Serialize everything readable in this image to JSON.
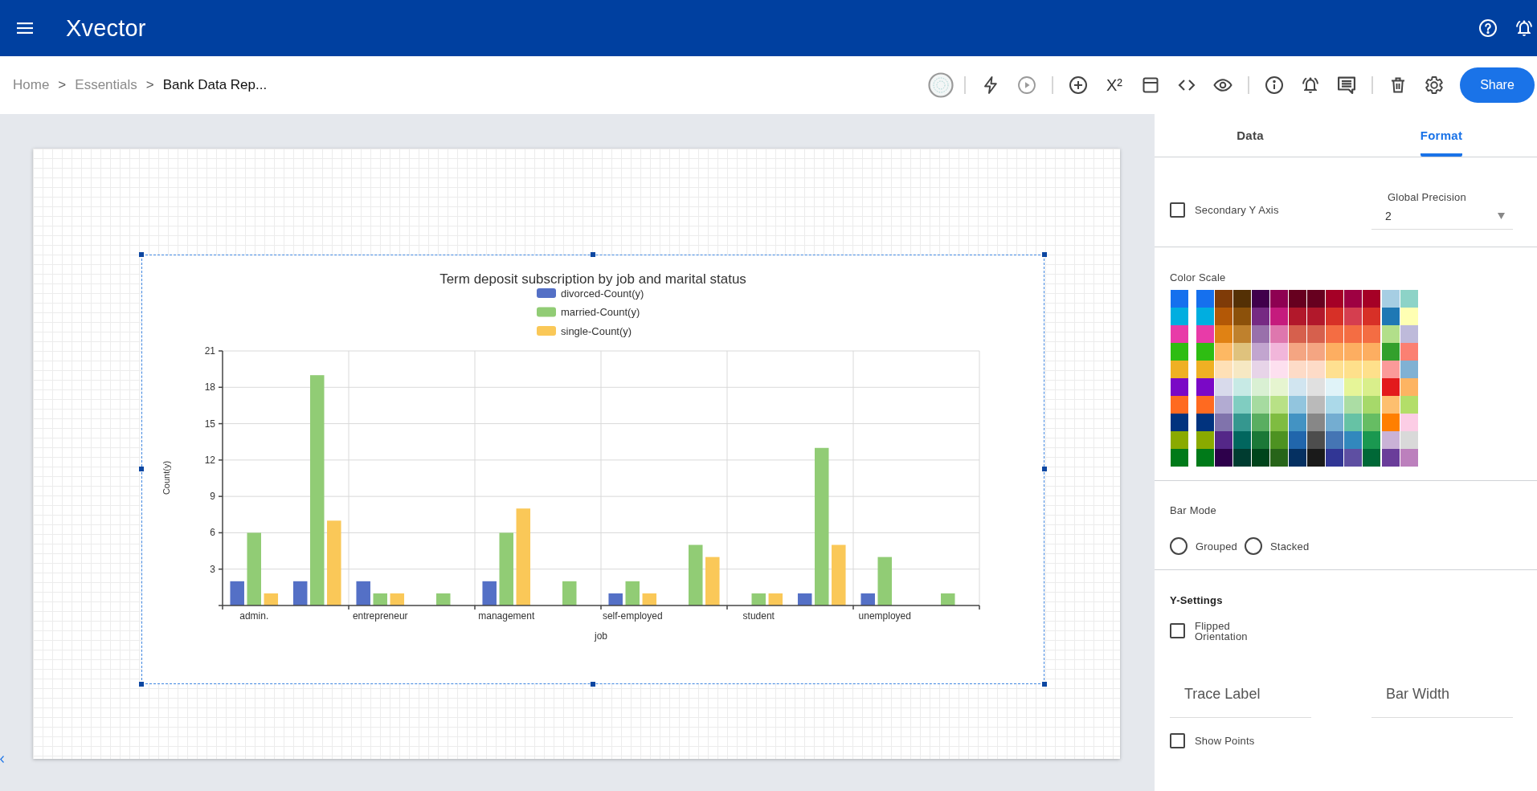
{
  "top_bar": {
    "logo": "Xvector"
  },
  "breadcrumb": [
    {
      "label": "Home",
      "current": false,
      "separator": ">"
    },
    {
      "label": "Essentials",
      "current": false,
      "separator": ">"
    },
    {
      "label": "Bank Data Rep...",
      "current": true
    }
  ],
  "toolbar": {
    "play_disabled": true,
    "superscript_label": "X²",
    "share_label": "Share"
  },
  "canvas": {
    "chart": {
      "selected": true,
      "chart_data": {
        "type": "bar",
        "title": "Term deposit subscription by job and marital status",
        "xlabel": "job",
        "ylabel": "Count(y)",
        "categories": [
          "admin.",
          null,
          "entrepreneur",
          null,
          "management",
          null,
          "self-employed",
          null,
          "student",
          null,
          "unemployed",
          null
        ],
        "ylim": [
          0,
          21
        ],
        "yticks": [
          3,
          6,
          9,
          12,
          15,
          18,
          21
        ],
        "grid": true,
        "legend": "top",
        "series": [
          {
            "name": "divorced-Count(y)",
            "color": "#5470c6",
            "values": [
              2,
              2,
              2,
              null,
              2,
              null,
              1,
              null,
              null,
              1,
              1,
              null
            ]
          },
          {
            "name": "married-Count(y)",
            "color": "#91cc75",
            "values": [
              6,
              19,
              1,
              1,
              6,
              2,
              2,
              5,
              1,
              13,
              4,
              1
            ]
          },
          {
            "name": "single-Count(y)",
            "color": "#fac858",
            "values": [
              1,
              7,
              1,
              null,
              8,
              null,
              1,
              4,
              1,
              5,
              null,
              null
            ]
          }
        ]
      }
    }
  },
  "format_panel": {
    "tabs": [
      {
        "label": "Data",
        "selected": false
      },
      {
        "label": "Format",
        "selected": true
      }
    ],
    "secondary_y_axis": {
      "label": "Secondary Y Axis",
      "checked": false
    },
    "global_precision": {
      "label": "Global Precision",
      "value": "2"
    },
    "color_scale": {
      "label": "Color Scale",
      "palettes": [
        {
          "swatches": [
            {
              "color": "#1570ee"
            },
            {
              "color": "#00aee0"
            },
            {
              "color": "#e83ba8"
            },
            {
              "color": "#2ebd12"
            },
            {
              "color": "#efb023"
            },
            {
              "color": "#7a08c6"
            },
            {
              "color": "#ff6a20"
            },
            {
              "color": "#01337e"
            },
            {
              "color": "#8aaa00"
            },
            {
              "color": "#007a19"
            }
          ]
        },
        {
          "swatches": [
            {
              "color": "#1570ee"
            },
            {
              "color": "#00aee0"
            },
            {
              "color": "#e83ba8"
            },
            {
              "color": "#2ebd12"
            },
            {
              "color": "#efb023"
            },
            {
              "color": "#7a08c6"
            },
            {
              "color": "#ff6a20"
            },
            {
              "color": "#01337e"
            },
            {
              "color": "#8aaa00"
            },
            {
              "color": "#007a19"
            }
          ]
        },
        {
          "swatches": [
            {
              "color": "#7f3b08"
            },
            {
              "color": "#b35806"
            },
            {
              "color": "#e08214"
            },
            {
              "color": "#fdb863"
            },
            {
              "color": "#fee0b6"
            },
            {
              "color": "#d8daeb"
            },
            {
              "color": "#b2abd2"
            },
            {
              "color": "#8073ac"
            },
            {
              "color": "#542788"
            },
            {
              "color": "#2d004b"
            }
          ]
        },
        {
          "swatches": [
            {
              "color": "#543005"
            },
            {
              "color": "#8c510a"
            },
            {
              "color": "#bf812d"
            },
            {
              "color": "#dfc27d"
            },
            {
              "color": "#f6e8c3"
            },
            {
              "color": "#c7eae5"
            },
            {
              "color": "#80cdc1"
            },
            {
              "color": "#35978f"
            },
            {
              "color": "#01665e"
            },
            {
              "color": "#003c30"
            }
          ]
        },
        {
          "swatches": [
            {
              "color": "#40004b"
            },
            {
              "color": "#762a83"
            },
            {
              "color": "#9970ab"
            },
            {
              "color": "#c2a5cf"
            },
            {
              "color": "#e7d4e8"
            },
            {
              "color": "#d9f0d3"
            },
            {
              "color": "#a6dba0"
            },
            {
              "color": "#5aae61"
            },
            {
              "color": "#1b7837"
            },
            {
              "color": "#00441b"
            }
          ]
        },
        {
          "swatches": [
            {
              "color": "#8e0152"
            },
            {
              "color": "#c51b7d"
            },
            {
              "color": "#de77ae"
            },
            {
              "color": "#f1b6da"
            },
            {
              "color": "#fde0ef"
            },
            {
              "color": "#e6f5d0"
            },
            {
              "color": "#b8e186"
            },
            {
              "color": "#7fbc41"
            },
            {
              "color": "#4d9221"
            },
            {
              "color": "#276419"
            }
          ]
        },
        {
          "swatches": [
            {
              "color": "#67001f"
            },
            {
              "color": "#b2182b"
            },
            {
              "color": "#d6604d"
            },
            {
              "color": "#f4a582"
            },
            {
              "color": "#fddbc7"
            },
            {
              "color": "#d1e5f0"
            },
            {
              "color": "#92c5de"
            },
            {
              "color": "#4393c3"
            },
            {
              "color": "#2166ac"
            },
            {
              "color": "#053061"
            }
          ]
        },
        {
          "swatches": [
            {
              "color": "#67001f"
            },
            {
              "color": "#b2182b"
            },
            {
              "color": "#d6604d"
            },
            {
              "color": "#f4a582"
            },
            {
              "color": "#fddbc7"
            },
            {
              "color": "#e0e0e0"
            },
            {
              "color": "#bababa"
            },
            {
              "color": "#878787"
            },
            {
              "color": "#4d4d4d"
            },
            {
              "color": "#1a1a1a"
            }
          ]
        },
        {
          "swatches": [
            {
              "color": "#a50026"
            },
            {
              "color": "#d73027"
            },
            {
              "color": "#f46d43"
            },
            {
              "color": "#fdae61"
            },
            {
              "color": "#fee090"
            },
            {
              "color": "#e0f3f8"
            },
            {
              "color": "#abd9e9"
            },
            {
              "color": "#74add1"
            },
            {
              "color": "#4575b4"
            },
            {
              "color": "#313695"
            }
          ]
        },
        {
          "swatches": [
            {
              "color": "#9e0142"
            },
            {
              "color": "#d53e4f"
            },
            {
              "color": "#f46d43"
            },
            {
              "color": "#fdae61"
            },
            {
              "color": "#fee08b"
            },
            {
              "color": "#e6f598"
            },
            {
              "color": "#abdda4"
            },
            {
              "color": "#66c2a5"
            },
            {
              "color": "#3288bd"
            },
            {
              "color": "#5e4fa2"
            }
          ]
        },
        {
          "swatches": [
            {
              "color": "#a50026"
            },
            {
              "color": "#d73027"
            },
            {
              "color": "#f46d43"
            },
            {
              "color": "#fdae61"
            },
            {
              "color": "#fee08b"
            },
            {
              "color": "#d9ef8b"
            },
            {
              "color": "#a6d96a"
            },
            {
              "color": "#66bd63"
            },
            {
              "color": "#1a9850"
            },
            {
              "color": "#006837"
            }
          ]
        },
        {
          "swatches": [
            {
              "color": "#a6cee3"
            },
            {
              "color": "#1f78b4"
            },
            {
              "color": "#b2df8a"
            },
            {
              "color": "#33a02c"
            },
            {
              "color": "#fb9a99"
            },
            {
              "color": "#e31a1c"
            },
            {
              "color": "#fdbf6f"
            },
            {
              "color": "#ff7f00"
            },
            {
              "color": "#cab2d6"
            },
            {
              "color": "#6a3d9a"
            }
          ]
        },
        {
          "swatches": [
            {
              "color": "#8dd3c7"
            },
            {
              "color": "#ffffb3"
            },
            {
              "color": "#bebada"
            },
            {
              "color": "#fb8072"
            },
            {
              "color": "#80b1d3"
            },
            {
              "color": "#fdb462"
            },
            {
              "color": "#b3de69"
            },
            {
              "color": "#fccde5"
            },
            {
              "color": "#d9d9d9"
            },
            {
              "color": "#bc80bd"
            }
          ]
        }
      ]
    },
    "bar_mode": {
      "label": "Bar Mode",
      "options": [
        {
          "label": "Grouped",
          "selected": false
        },
        {
          "label": "Stacked",
          "selected": false
        }
      ]
    },
    "y_settings": {
      "label": "Y-Settings",
      "flipped_orientation": {
        "label": "Flipped Orientation",
        "checked": false
      }
    },
    "fields": [
      {
        "placeholder": "Trace Label"
      },
      {
        "placeholder": "Bar Width"
      }
    ],
    "show_points": {
      "label": "Show Points",
      "checked": false
    }
  }
}
